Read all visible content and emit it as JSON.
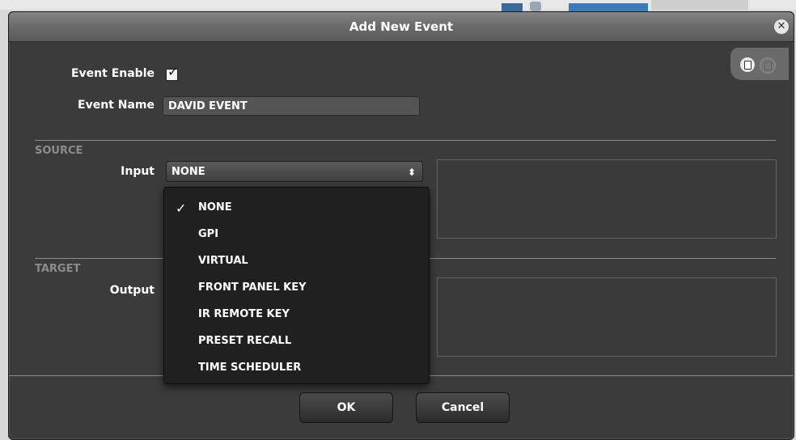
{
  "dialog": {
    "title": "Add New Event",
    "close_glyph": "✕"
  },
  "form": {
    "event_enable_label": "Event Enable",
    "event_enable_checked": true,
    "event_name_label": "Event Name",
    "event_name_value": "DAVID EVENT"
  },
  "source": {
    "section_label": "SOURCE",
    "input_label": "Input",
    "input_selected": "NONE",
    "options": [
      "NONE",
      "GPI",
      "VIRTUAL",
      "FRONT PANEL KEY",
      "IR REMOTE KEY",
      "PRESET RECALL",
      "TIME SCHEDULER"
    ]
  },
  "target": {
    "section_label": "TARGET",
    "output_label": "Output"
  },
  "buttons": {
    "ok": "OK",
    "cancel": "Cancel"
  },
  "icons": {
    "toolbar": [
      "copy-icon",
      "paste-icon"
    ],
    "select_arrows": "updown-arrows-icon",
    "checkmark": "checkmark-icon"
  },
  "colors": {
    "dialog_bg": "#3b3b3b",
    "titlebar": "#6a6a6a",
    "dropdown_bg": "#202020",
    "section_text": "#8c8c8c"
  }
}
